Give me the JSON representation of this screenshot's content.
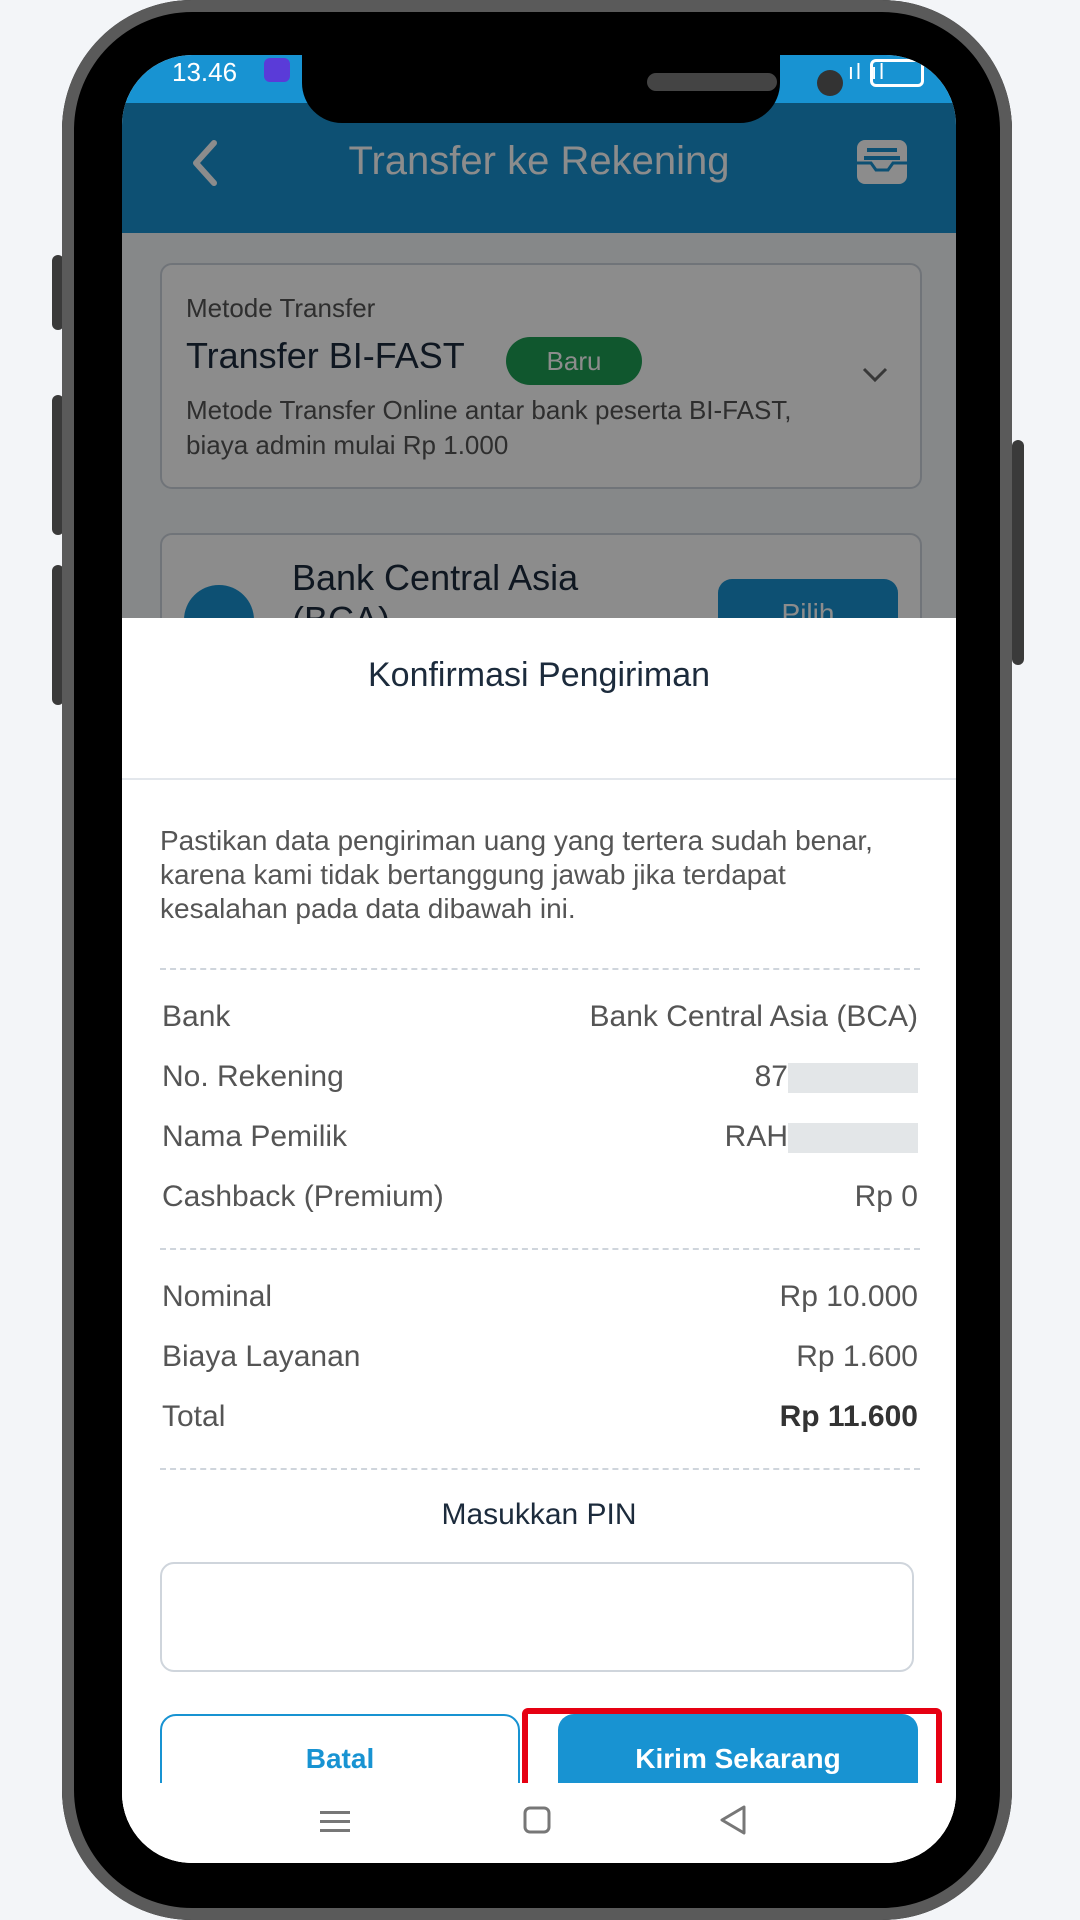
{
  "status_bar": {
    "time": "13.46",
    "signal": "ıl ıl"
  },
  "header": {
    "title": "Transfer ke Rekening"
  },
  "background": {
    "method_label": "Metode Transfer",
    "method_title": "Transfer BI-FAST",
    "method_badge": "Baru",
    "method_desc": "Metode Transfer Online antar bank peserta BI-FAST, biaya admin mulai Rp 1.000",
    "bank_name": "Bank Central Asia (BCA)",
    "select_button": "Pilih"
  },
  "modal": {
    "title": "Konfirmasi Pengiriman",
    "note": "Pastikan data pengiriman uang yang tertera sudah benar, karena kami tidak bertanggung jawab jika terdapat kesalahan pada data dibawah ini.",
    "details": [
      {
        "label": "Bank",
        "value": "Bank Central Asia (BCA)"
      },
      {
        "label": "No. Rekening",
        "value": "87"
      },
      {
        "label": "Nama Pemilik",
        "value": "RAH"
      },
      {
        "label": "Cashback (Premium)",
        "value": "Rp 0"
      }
    ],
    "amounts": [
      {
        "label": "Nominal",
        "value": "Rp 10.000"
      },
      {
        "label": "Biaya Layanan",
        "value": "Rp 1.600"
      },
      {
        "label": "Total",
        "value": "Rp 11.600"
      }
    ],
    "pin_label": "Masukkan PIN",
    "pin_value": "",
    "cancel_button": "Batal",
    "send_button": "Kirim Sekarang"
  },
  "colors": {
    "primary": "#1893d2",
    "badge": "#1e9e55",
    "highlight": "#e60012"
  }
}
